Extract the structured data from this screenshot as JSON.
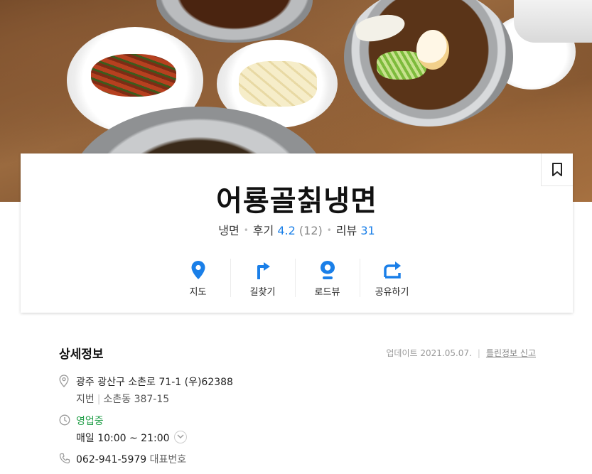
{
  "place": {
    "name": "어룡골칡냉면",
    "category": "냉면",
    "review_label": "후기",
    "rating": "4.2",
    "rating_count": "(12)",
    "blog_label": "리뷰",
    "blog_count": "31"
  },
  "actions": [
    {
      "label": "지도",
      "icon": "map-pin-icon"
    },
    {
      "label": "길찾기",
      "icon": "directions-icon"
    },
    {
      "label": "로드뷰",
      "icon": "roadview-icon"
    },
    {
      "label": "공유하기",
      "icon": "share-icon"
    }
  ],
  "detail": {
    "title": "상세정보",
    "updated": "업데이트 2021.05.07.",
    "report_link": "틀린정보 신고",
    "address": "광주 광산구 소촌로 71-1 (우)62388",
    "lot_label": "지번",
    "lot_address": "소촌동 387-15",
    "status": "영업중",
    "hours": "매일  10:00 ~ 21:00",
    "phone": "062-941-5979",
    "phone_tag": "대표번호"
  },
  "colors": {
    "accent_blue": "#1a7fe8",
    "open_green": "#25a04b"
  }
}
